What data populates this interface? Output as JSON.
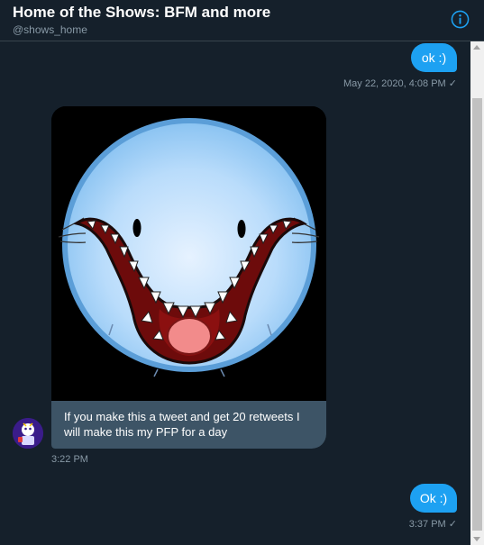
{
  "header": {
    "title": "Home of the Shows: BFM and more",
    "handle": "@shows_home",
    "info_icon": "info-icon"
  },
  "messages": [
    {
      "direction": "outgoing",
      "text": "ok :)",
      "timestamp": "May 22, 2020, 4:08 PM ✓"
    },
    {
      "direction": "incoming",
      "media": "blue-smiling-face-image",
      "caption": "If you make this a tweet and get 20 retweets I will make this my PFP for a day",
      "timestamp": "3:22 PM"
    },
    {
      "direction": "outgoing",
      "text": "Ok :)",
      "timestamp": "3:37 PM ✓"
    }
  ],
  "colors": {
    "background": "#15202b",
    "outgoing_bubble": "#1da1f2",
    "incoming_bubble": "#3d5466",
    "muted_text": "#8899a6"
  }
}
